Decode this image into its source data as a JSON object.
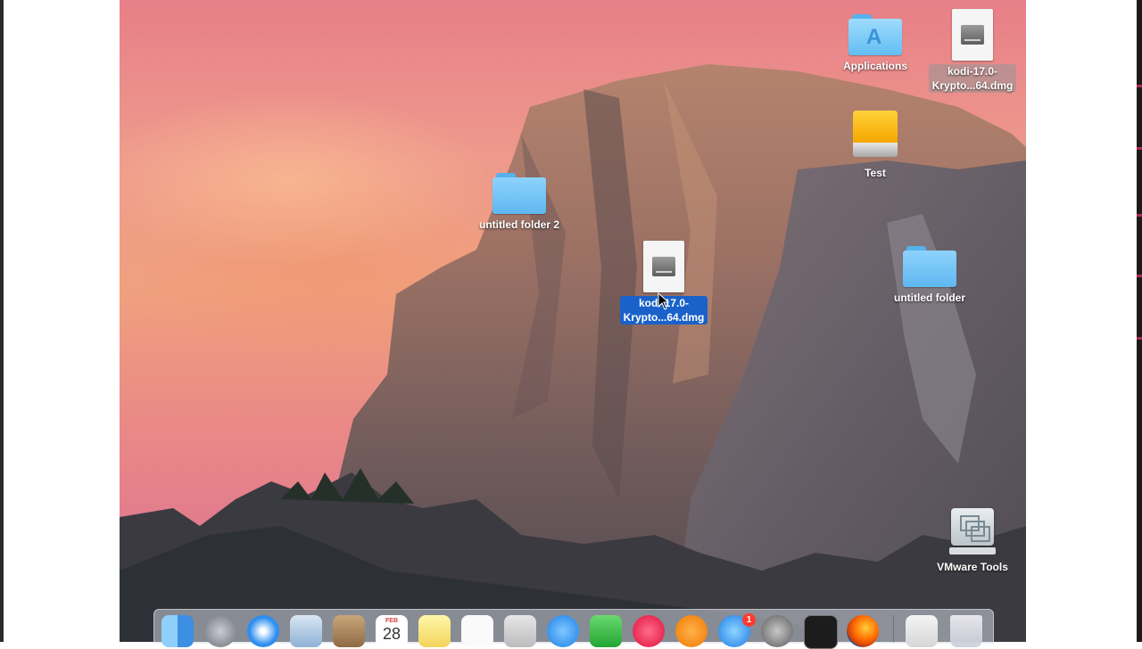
{
  "desktop": {
    "icons": {
      "applications": {
        "label": "Applications"
      },
      "kodi_top": {
        "label_line1": "kodi-17.0-",
        "label_line2": "Krypto...64.dmg"
      },
      "test": {
        "label": "Test"
      },
      "untitled_folder_2": {
        "label": "untitled folder 2"
      },
      "kodi_center": {
        "label_line1": "kodi-17.0-",
        "label_line2": "Krypto...64.dmg"
      },
      "untitled_folder": {
        "label": "untitled folder"
      },
      "vmware_tools": {
        "label": "VMware Tools"
      }
    }
  },
  "dock": {
    "calendar_month": "FEB",
    "calendar_day": "28",
    "app_store_badge": "1",
    "icons": [
      "finder-icon",
      "launchpad-icon",
      "safari-icon",
      "mail-icon",
      "contacts-icon",
      "calendar-icon",
      "notes-icon",
      "reminders-icon",
      "photos-icon",
      "messages-icon",
      "facetime-icon",
      "itunes-icon",
      "ibooks-icon",
      "app-store-icon",
      "system-preferences-icon",
      "activity-monitor-icon",
      "firefox-icon",
      "downloads-stack-icon",
      "trash-icon"
    ]
  },
  "colors": {
    "selection_blue": "#1a62c9",
    "folder_blue": "#5fb8f1"
  }
}
